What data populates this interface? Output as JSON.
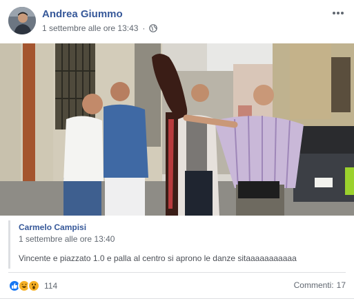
{
  "post": {
    "author": "Andrea Giummo",
    "timestamp": "1 settembre alle ore 13:43",
    "privacy_icon": "globe-icon",
    "menu_icon": "more-horizontal-icon"
  },
  "shared_post": {
    "author": "Carmelo Campisi",
    "timestamp": "1 settembre alle ore 13:40",
    "text": "Vincente e piazzato 1.0 e palla al centro si aprono le danze sitaaaaaaaaaaa"
  },
  "footer": {
    "reactions": [
      "like-icon",
      "haha-icon",
      "wow-icon"
    ],
    "reaction_count": "114",
    "comments_label": "Commenti:",
    "comments_count": "17"
  },
  "colors": {
    "link": "#365899",
    "secondary_text": "#606770",
    "like_blue": "#1877f2",
    "emoji_yellow": "#f7b125"
  }
}
